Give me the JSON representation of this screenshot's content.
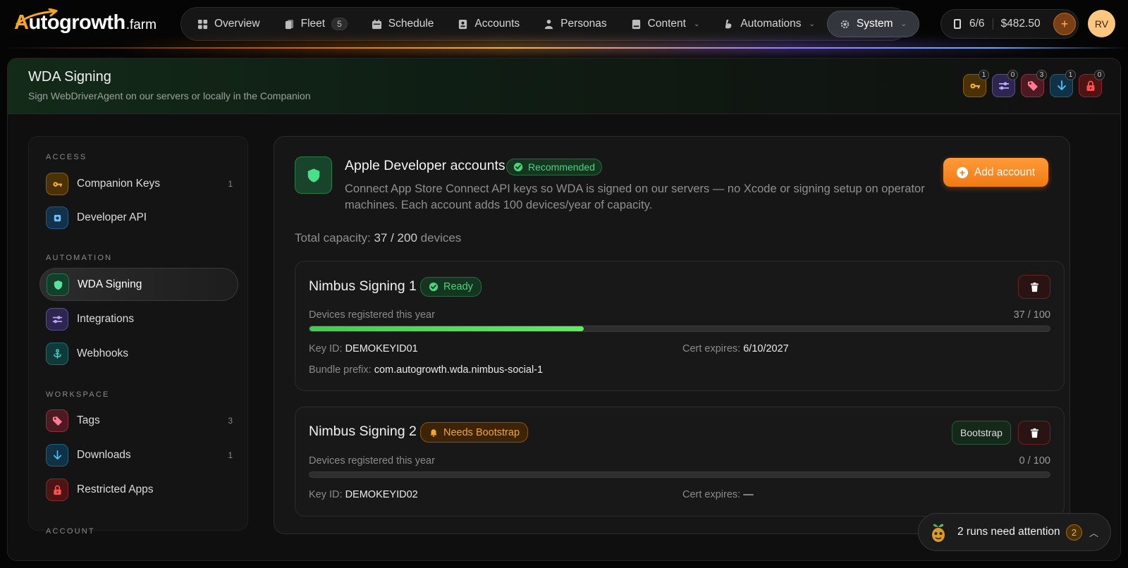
{
  "brand": {
    "main": "utogrowth",
    "first_letter": "A",
    "suffix": ".farm"
  },
  "nav": {
    "items": [
      {
        "label": "Overview",
        "icon": "grid-icon"
      },
      {
        "label": "Fleet",
        "icon": "phone-stack-icon",
        "badge": "5"
      },
      {
        "label": "Schedule",
        "icon": "calendar-icon"
      },
      {
        "label": "Accounts",
        "icon": "id-card-icon"
      },
      {
        "label": "Personas",
        "icon": "person-icon"
      },
      {
        "label": "Content",
        "icon": "document-icon",
        "has_menu": true
      },
      {
        "label": "Automations",
        "icon": "script-icon",
        "has_menu": true
      },
      {
        "label": "System",
        "icon": "gear-icon",
        "has_menu": true,
        "active": true
      }
    ]
  },
  "wallet": {
    "devices": "6/6",
    "balance": "$482.50",
    "add_label": "+"
  },
  "user": {
    "initials": "RV"
  },
  "page": {
    "title": "WDA Signing",
    "subtitle": "Sign WebDriverAgent on our servers or locally in the Companion"
  },
  "header_counters": [
    {
      "icon": "key-icon",
      "count": "1"
    },
    {
      "icon": "sliders-icon",
      "count": "0"
    },
    {
      "icon": "tag-icon",
      "count": "3"
    },
    {
      "icon": "download-icon",
      "count": "1"
    },
    {
      "icon": "lock-icon",
      "count": "0"
    }
  ],
  "sidebar": {
    "sections": [
      {
        "label": "ACCESS"
      },
      {
        "label": "AUTOMATION"
      },
      {
        "label": "WORKSPACE"
      },
      {
        "label": "ACCOUNT"
      }
    ],
    "items": [
      {
        "label": "Companion Keys",
        "count": "1",
        "icon": "key-icon"
      },
      {
        "label": "Developer API",
        "count": "",
        "icon": "api-icon"
      },
      {
        "label": "WDA Signing",
        "count": "",
        "icon": "shield-icon",
        "active": true
      },
      {
        "label": "Integrations",
        "count": "",
        "icon": "sliders-icon"
      },
      {
        "label": "Webhooks",
        "count": "",
        "icon": "anchor-icon"
      },
      {
        "label": "Tags",
        "count": "3",
        "icon": "tag-icon"
      },
      {
        "label": "Downloads",
        "count": "1",
        "icon": "download-icon"
      },
      {
        "label": "Restricted Apps",
        "count": "",
        "icon": "lock-icon"
      }
    ]
  },
  "main": {
    "title": "Apple Developer accounts",
    "recommended": "Recommended",
    "description": "Connect App Store Connect API keys so WDA is signed on our servers — no Xcode or signing setup on operator machines. Each account adds 100 devices/year of capacity.",
    "add_button": "Add account",
    "capacity_label": "Total capacity:",
    "capacity_value": "37 / 200",
    "capacity_unit": "devices",
    "accounts": [
      {
        "name": "Nimbus Signing 1",
        "status": "Ready",
        "devices_label": "Devices registered this year",
        "devices_ratio": "37 / 100",
        "devices_fraction": 0.37,
        "key_label": "Key ID:",
        "key_id": "DEMOKEYID01",
        "cert_label": "Cert expires:",
        "cert_expires": "6/10/2027",
        "bundle_label": "Bundle prefix:",
        "bundle_prefix": "com.autogrowth.wda.nimbus-social-1"
      },
      {
        "name": "Nimbus Signing 2",
        "status": "Needs Bootstrap",
        "bootstrap_button": "Bootstrap",
        "devices_label": "Devices registered this year",
        "devices_ratio": "0 / 100",
        "devices_fraction": 0,
        "key_label": "Key ID:",
        "key_id": "DEMOKEYID02",
        "cert_label": "Cert expires:",
        "cert_expires": "—"
      }
    ]
  },
  "toast": {
    "text": "2 runs need attention",
    "count": "2"
  },
  "colors": {
    "accent": "#f07a12",
    "success": "#4fd27d",
    "warning": "#f2a33a",
    "danger": "#ff4f4f"
  }
}
